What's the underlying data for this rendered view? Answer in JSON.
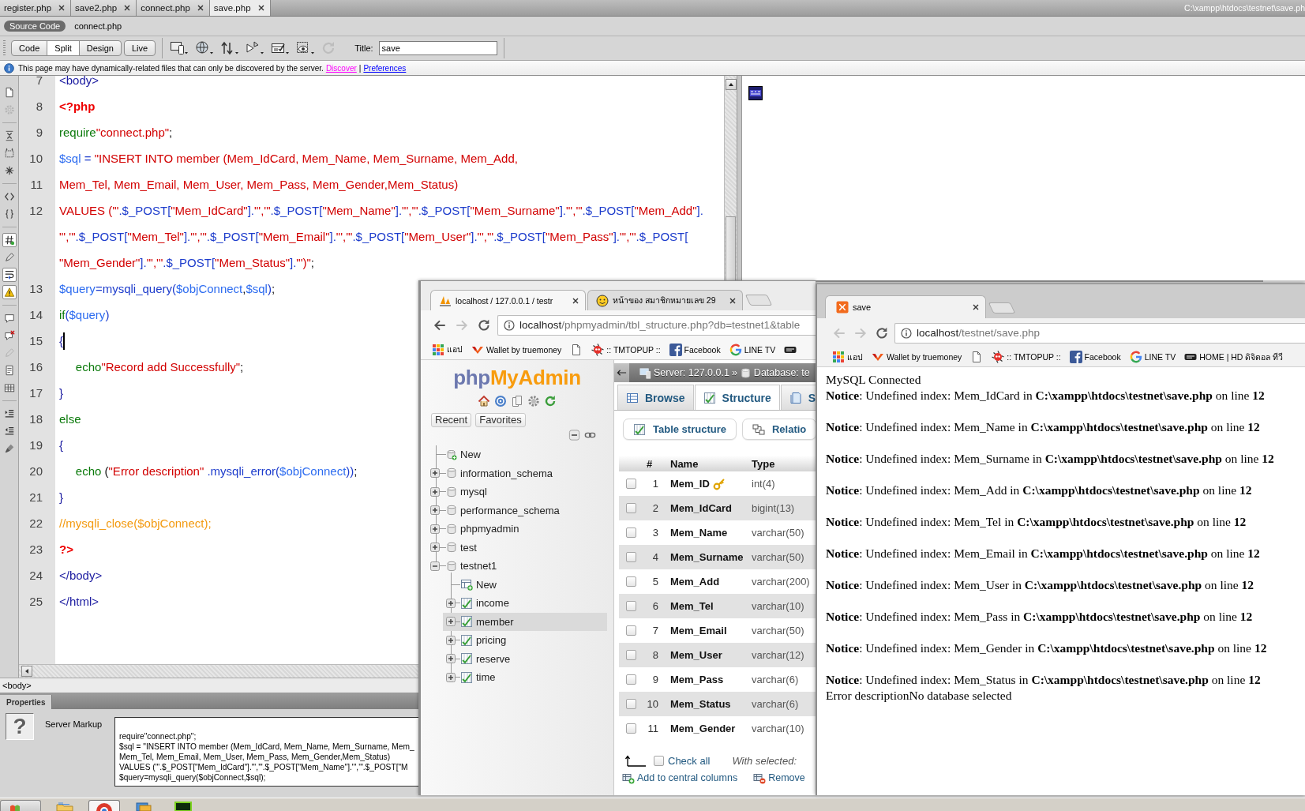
{
  "editor": {
    "document_tabs": [
      {
        "label": "register.php",
        "selected": false
      },
      {
        "label": "save2.php",
        "selected": false
      },
      {
        "label": "connect.php",
        "selected": false
      },
      {
        "label": "save.php",
        "selected": true
      }
    ],
    "file_path": "C:\\xampp\\htdocs\\testnet\\save.ph",
    "related_files": [
      {
        "label": "Source Code",
        "selected": true
      },
      {
        "label": "connect.php",
        "selected": false
      }
    ],
    "view_buttons": [
      {
        "label": "Code",
        "selected": false
      },
      {
        "label": "Split",
        "selected": true
      },
      {
        "label": "Design",
        "selected": false
      },
      {
        "label": "Live",
        "selected": false
      }
    ],
    "tools": [
      {
        "disabled": false
      },
      {
        "disabled": false
      },
      {
        "disabled": false
      },
      {
        "disabled": false
      },
      {
        "disabled": false
      },
      {
        "disabled": false
      },
      {
        "disabled": true
      }
    ],
    "title_label": "Title:",
    "title_value": "save",
    "info_bar": {
      "message": "This page may have dynamically-related files that can only be discovered by the server.",
      "links": [
        {
          "label": "Discover",
          "color": "#ff00ff"
        },
        {
          "label": "Preferences",
          "color": "#0000ff"
        }
      ],
      "separator": "|"
    },
    "code_toolbar": [
      {
        "on": false
      },
      {
        "on": false
      },
      {
        "on": false
      },
      {
        "on": false
      },
      {
        "on": false
      },
      {
        "on": false
      },
      {
        "on": false
      },
      {
        "on": true
      },
      {
        "on": false
      },
      {
        "on": true
      },
      {
        "on": true
      },
      {
        "on": false
      },
      {
        "on": false
      },
      {
        "on": false
      },
      {
        "on": false
      },
      {
        "on": false
      },
      {
        "on": false
      },
      {
        "on": false
      },
      {
        "on": false
      }
    ],
    "code_rows": [
      {
        "number": "7",
        "cursor": false,
        "tokens": [
          {
            "kind": "tag",
            "text": "<body>"
          }
        ]
      },
      {
        "number": "8",
        "cursor": false,
        "tokens": [
          {
            "kind": "php",
            "text": "<?php"
          }
        ]
      },
      {
        "number": "9",
        "cursor": false,
        "tokens": [
          {
            "kind": "keyword",
            "text": "require"
          },
          {
            "kind": "string",
            "text": "\"connect.php\""
          },
          {
            "kind": "punct",
            "text": ";"
          }
        ]
      },
      {
        "number": "10",
        "cursor": false,
        "tokens": [
          {
            "kind": "variable",
            "text": "$sql"
          },
          {
            "kind": "operator",
            "text": " = "
          },
          {
            "kind": "string",
            "text": "\"INSERT INTO member (Mem_IdCard, Mem_Name, Mem_Surname, Mem_Add,"
          }
        ]
      },
      {
        "number": "11",
        "cursor": false,
        "tokens": [
          {
            "kind": "string",
            "text": "Mem_Tel, Mem_Email, Mem_User, Mem_Pass, Mem_Gender,Mem_Status)"
          }
        ]
      },
      {
        "number": "12",
        "cursor": false,
        "tokens": [
          {
            "kind": "string",
            "text": "VALUES ('\""
          },
          {
            "kind": "operator",
            "text": ".$_POST["
          },
          {
            "kind": "string",
            "text": "\"Mem_IdCard\""
          },
          {
            "kind": "operator",
            "text": "]."
          },
          {
            "kind": "string",
            "text": "\"','\""
          },
          {
            "kind": "operator",
            "text": ".$_POST["
          },
          {
            "kind": "string",
            "text": "\"Mem_Name\""
          },
          {
            "kind": "operator",
            "text": "]."
          },
          {
            "kind": "string",
            "text": "\"','\""
          },
          {
            "kind": "operator",
            "text": ".$_POST["
          },
          {
            "kind": "string",
            "text": "\"Mem_Surname\""
          },
          {
            "kind": "operator",
            "text": "]."
          },
          {
            "kind": "string",
            "text": "\"','\""
          },
          {
            "kind": "operator",
            "text": ".$_POST["
          },
          {
            "kind": "string",
            "text": "\"Mem_Add\""
          },
          {
            "kind": "operator",
            "text": "]."
          }
        ]
      },
      {
        "cursor": false,
        "tokens": [
          {
            "kind": "string",
            "text": "\"','\""
          },
          {
            "kind": "operator",
            "text": ".$_POST["
          },
          {
            "kind": "string",
            "text": "\"Mem_Tel\""
          },
          {
            "kind": "operator",
            "text": "]."
          },
          {
            "kind": "string",
            "text": "\"','\""
          },
          {
            "kind": "operator",
            "text": ".$_POST["
          },
          {
            "kind": "string",
            "text": "\"Mem_Email\""
          },
          {
            "kind": "operator",
            "text": "]."
          },
          {
            "kind": "string",
            "text": "\"','\""
          },
          {
            "kind": "operator",
            "text": ".$_POST["
          },
          {
            "kind": "string",
            "text": "\"Mem_User\""
          },
          {
            "kind": "operator",
            "text": "]."
          },
          {
            "kind": "string",
            "text": "\"','\""
          },
          {
            "kind": "operator",
            "text": ".$_POST["
          },
          {
            "kind": "string",
            "text": "\"Mem_Pass\""
          },
          {
            "kind": "operator",
            "text": "]."
          },
          {
            "kind": "string",
            "text": "\"','\""
          },
          {
            "kind": "operator",
            "text": ".$_POST["
          }
        ]
      },
      {
        "cursor": false,
        "tokens": [
          {
            "kind": "string",
            "text": "\"Mem_Gender\""
          },
          {
            "kind": "operator",
            "text": "]."
          },
          {
            "kind": "string",
            "text": "\"','\""
          },
          {
            "kind": "operator",
            "text": ".$_POST["
          },
          {
            "kind": "string",
            "text": "\"Mem_Status\""
          },
          {
            "kind": "operator",
            "text": "]."
          },
          {
            "kind": "string",
            "text": "\"')\""
          },
          {
            "kind": "punct",
            "text": ";"
          }
        ]
      },
      {
        "number": "13",
        "cursor": false,
        "tokens": [
          {
            "kind": "variable",
            "text": "$query"
          },
          {
            "kind": "operator",
            "text": "="
          },
          {
            "kind": "function",
            "text": "mysqli_query("
          },
          {
            "kind": "variable",
            "text": "$objConnect"
          },
          {
            "kind": "punct",
            "text": ","
          },
          {
            "kind": "variable",
            "text": "$sql"
          },
          {
            "kind": "function",
            "text": ")"
          },
          {
            "kind": "punct",
            "text": ";"
          }
        ]
      },
      {
        "number": "14",
        "cursor": false,
        "tokens": [
          {
            "kind": "keyword",
            "text": "if"
          },
          {
            "kind": "function",
            "text": "("
          },
          {
            "kind": "variable",
            "text": "$query"
          },
          {
            "kind": "function",
            "text": ")"
          }
        ]
      },
      {
        "number": "15",
        "cursor": true,
        "tokens": [
          {
            "kind": "brace",
            "text": "{"
          }
        ]
      },
      {
        "number": "16",
        "cursor": false,
        "tokens": [
          {
            "kind": "keyword",
            "text": "\techo"
          },
          {
            "kind": "string",
            "text": "\"Record add Successfully\""
          },
          {
            "kind": "punct",
            "text": ";"
          }
        ]
      },
      {
        "number": "17",
        "cursor": false,
        "tokens": [
          {
            "kind": "brace",
            "text": "}"
          }
        ]
      },
      {
        "number": "18",
        "cursor": false,
        "tokens": [
          {
            "kind": "keyword",
            "text": "else"
          }
        ]
      },
      {
        "number": "19",
        "cursor": false,
        "tokens": [
          {
            "kind": "brace",
            "text": "{"
          }
        ]
      },
      {
        "number": "20",
        "cursor": false,
        "tokens": [
          {
            "kind": "keyword",
            "text": "\techo"
          },
          {
            "kind": "punct",
            "text": " ("
          },
          {
            "kind": "string",
            "text": "\"Error description\""
          },
          {
            "kind": "function",
            "text": " .mysqli_error("
          },
          {
            "kind": "variable",
            "text": "$objConnect"
          },
          {
            "kind": "function",
            "text": "))"
          },
          {
            "kind": "punct",
            "text": ";"
          }
        ]
      },
      {
        "number": "21",
        "cursor": false,
        "tokens": [
          {
            "kind": "brace",
            "text": "}"
          }
        ]
      },
      {
        "number": "22",
        "cursor": false,
        "tokens": [
          {
            "kind": "comment",
            "text": "//mysqli_close($objConnect);"
          }
        ]
      },
      {
        "number": "23",
        "cursor": false,
        "tokens": [
          {
            "kind": "php",
            "text": "?>"
          }
        ]
      },
      {
        "number": "24",
        "cursor": false,
        "tokens": [
          {
            "kind": "tag",
            "text": "</body>"
          }
        ]
      },
      {
        "number": "25",
        "cursor": false,
        "tokens": [
          {
            "kind": "tag",
            "text": "</html>"
          }
        ]
      }
    ],
    "tag_selector": "<body>",
    "properties": {
      "title": "Properties",
      "icon_glyph": "?",
      "type_label": "Server Markup",
      "markup_lines": [
        "require\"connect.php\";",
        "$sql = \"INSERT INTO member (Mem_IdCard, Mem_Name, Mem_Surname, Mem_",
        "Mem_Tel, Mem_Email, Mem_User, Mem_Pass, Mem_Gender,Mem_Status)",
        "VALUES ('\".$_POST[\"Mem_IdCard\"].\"','\".$_POST[\"Mem_Name\"].\"','\".$_POST[\"M",
        "$query=mysqli_query($objConnect,$sql);"
      ]
    }
  },
  "pma_window": {
    "tabs": [
      {
        "title": "localhost / 127.0.0.1 / testr",
        "selected": true
      },
      {
        "title": "หน้าของ สมาชิกหมายเลข 29",
        "selected": false
      }
    ],
    "nav": {
      "back_disabled": false,
      "forward_disabled": true
    },
    "url": {
      "host": "localhost",
      "path": "/phpmyadmin/tbl_structure.php?db=testnet1&table"
    },
    "bookmarks": [
      {
        "kind": "apps",
        "label": "แอป"
      },
      {
        "kind": "wallet",
        "label": "Wallet by truemoney"
      },
      {
        "kind": "page"
      },
      {
        "kind": "tmtopup",
        "label": ":: TMTOPUP ::"
      },
      {
        "kind": "facebook",
        "label": "Facebook"
      },
      {
        "kind": "google",
        "label": "LINE TV"
      },
      {
        "kind": "device"
      }
    ],
    "logo": {
      "php": "php",
      "rest": "MyAdmin"
    },
    "nav_buttons": [
      "Recent",
      "Favorites"
    ],
    "tree": [
      {
        "kind": "new",
        "label": "New",
        "selected": false
      },
      {
        "kind": "database",
        "label": "information_schema",
        "expanded": false,
        "selected": false
      },
      {
        "kind": "database",
        "label": "mysql",
        "expanded": false,
        "selected": false
      },
      {
        "kind": "database",
        "label": "performance_schema",
        "expanded": false,
        "selected": false
      },
      {
        "kind": "database",
        "label": "phpmyadmin",
        "expanded": false,
        "selected": false
      },
      {
        "kind": "database",
        "label": "test",
        "expanded": false,
        "selected": false
      },
      {
        "kind": "database",
        "label": "testnet1",
        "expanded": true,
        "selected": false,
        "children": [
          {
            "kind": "new",
            "label": "New",
            "selected": false
          },
          {
            "kind": "table",
            "label": "income",
            "expanded": false,
            "selected": false
          },
          {
            "kind": "table",
            "label": "member",
            "expanded": false,
            "selected": true
          },
          {
            "kind": "table",
            "label": "pricing",
            "expanded": false,
            "selected": false
          },
          {
            "kind": "table",
            "label": "reserve",
            "expanded": false,
            "selected": false
          },
          {
            "kind": "table",
            "label": "time",
            "expanded": false,
            "selected": false
          }
        ]
      }
    ],
    "breadcrumb": {
      "items": [
        "Server: 127.0.0.1",
        "Database: te"
      ],
      "separator": "»"
    },
    "tabs_main": [
      {
        "label": "Browse",
        "selected": false
      },
      {
        "label": "Structure",
        "selected": true
      },
      {
        "label": "S",
        "selected": false
      }
    ],
    "subtabs": [
      "Table structure",
      "Relatio"
    ],
    "table": {
      "columns": [
        "#",
        "Name",
        "Type"
      ],
      "rows": [
        {
          "number": "1",
          "name": "Mem_ID",
          "type": "int(4)",
          "primary": true,
          "checked": false
        },
        {
          "number": "2",
          "name": "Mem_IdCard",
          "type": "bigint(13)",
          "primary": false,
          "checked": false
        },
        {
          "number": "3",
          "name": "Mem_Name",
          "type": "varchar(50)",
          "primary": false,
          "checked": false
        },
        {
          "number": "4",
          "name": "Mem_Surname",
          "type": "varchar(50)",
          "primary": false,
          "checked": false
        },
        {
          "number": "5",
          "name": "Mem_Add",
          "type": "varchar(200)",
          "primary": false,
          "checked": false
        },
        {
          "number": "6",
          "name": "Mem_Tel",
          "type": "varchar(10)",
          "primary": false,
          "checked": false
        },
        {
          "number": "7",
          "name": "Mem_Email",
          "type": "varchar(50)",
          "primary": false,
          "checked": false
        },
        {
          "number": "8",
          "name": "Mem_User",
          "type": "varchar(12)",
          "primary": false,
          "checked": false
        },
        {
          "number": "9",
          "name": "Mem_Pass",
          "type": "varchar(6)",
          "primary": false,
          "checked": false
        },
        {
          "number": "10",
          "name": "Mem_Status",
          "type": "varchar(6)",
          "primary": false,
          "checked": false
        },
        {
          "number": "11",
          "name": "Mem_Gender",
          "type": "varchar(10)",
          "primary": false,
          "checked": false
        }
      ]
    },
    "footer": {
      "check_all": {
        "label": "Check all",
        "checked": false
      },
      "with_selected": "With selected:",
      "actions": [
        {
          "kind": "add",
          "label": "Add to central columns"
        },
        {
          "kind": "remove",
          "label": "Remove"
        }
      ]
    }
  },
  "save_window": {
    "tabs": [
      {
        "title": "save",
        "selected": true
      }
    ],
    "nav": {
      "back_disabled": true,
      "forward_disabled": true
    },
    "url": {
      "host": "localhost",
      "path": "/testnet/save.php"
    },
    "bookmarks": [
      {
        "kind": "apps",
        "label": "แอป"
      },
      {
        "kind": "wallet",
        "label": "Wallet by truemoney"
      },
      {
        "kind": "page"
      },
      {
        "kind": "tmtopup",
        "label": ":: TMTOPUP ::"
      },
      {
        "kind": "facebook",
        "label": "Facebook"
      },
      {
        "kind": "google",
        "label": "LINE TV"
      },
      {
        "kind": "device",
        "label": "HOME | HD ดิจิตอล ทีวี"
      }
    ],
    "page_lines": [
      {
        "kind": "plain",
        "text": "MySQL Connected"
      },
      {
        "kind": "notice",
        "text": "**Notice**: Undefined index: Mem_IdCard in **C:\\xampp\\htdocs\\testnet\\save.php** on line **12**"
      },
      {
        "kind": "notice",
        "text": "**Notice**: Undefined index: Mem_Name in **C:\\xampp\\htdocs\\testnet\\save.php** on line **12**"
      },
      {
        "kind": "notice",
        "text": "**Notice**: Undefined index: Mem_Surname in **C:\\xampp\\htdocs\\testnet\\save.php** on line **12**"
      },
      {
        "kind": "notice",
        "text": "**Notice**: Undefined index: Mem_Add in **C:\\xampp\\htdocs\\testnet\\save.php** on line **12**"
      },
      {
        "kind": "notice",
        "text": "**Notice**: Undefined index: Mem_Tel in **C:\\xampp\\htdocs\\testnet\\save.php** on line **12**"
      },
      {
        "kind": "notice",
        "text": "**Notice**: Undefined index: Mem_Email in **C:\\xampp\\htdocs\\testnet\\save.php** on line **12**"
      },
      {
        "kind": "notice",
        "text": "**Notice**: Undefined index: Mem_User in **C:\\xampp\\htdocs\\testnet\\save.php** on line **12**"
      },
      {
        "kind": "notice",
        "text": "**Notice**: Undefined index: Mem_Pass in **C:\\xampp\\htdocs\\testnet\\save.php** on line **12**"
      },
      {
        "kind": "notice",
        "text": "**Notice**: Undefined index: Mem_Gender in **C:\\xampp\\htdocs\\testnet\\save.php** on line **12**"
      },
      {
        "kind": "notice",
        "text": "**Notice**: Undefined index: Mem_Status in **C:\\xampp\\htdocs\\testnet\\save.php** on line **12**"
      },
      {
        "kind": "plain",
        "text": "Error descriptionNo database selected"
      }
    ]
  },
  "taskbar": [
    {
      "kind": "start",
      "selected": false
    },
    {
      "kind": "folder",
      "selected": false
    },
    {
      "kind": "browser",
      "selected": true
    },
    {
      "kind": "windows",
      "selected": false
    },
    {
      "kind": "editor",
      "selected": false
    }
  ]
}
